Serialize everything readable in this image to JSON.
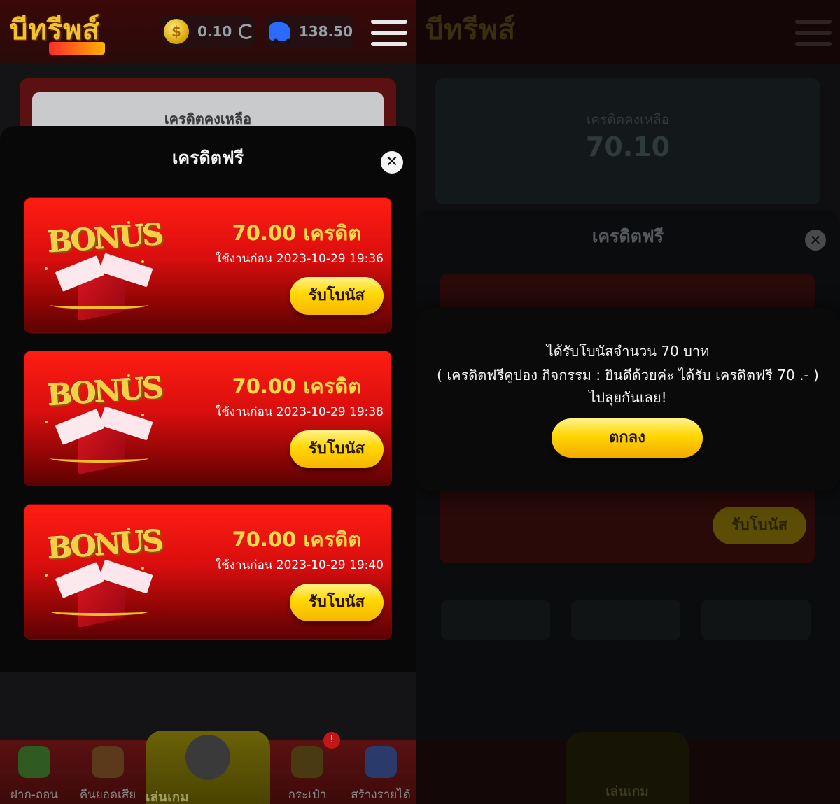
{
  "header": {
    "logo_text": "บีทรีพส์",
    "coin_balance": "0.10",
    "credit_balance": "138.50",
    "coin_icon": "$"
  },
  "credit_summary": {
    "label": "เครดิตคงเหลือ"
  },
  "sheet": {
    "title": "เครดิตฟรี",
    "close_symbol": "✕",
    "bonus_word": "BONUS",
    "items": [
      {
        "amount": "70.00 เครดิต",
        "expire": "ใช้งานก่อน 2023-10-29 19:36",
        "button": "รับโบนัส"
      },
      {
        "amount": "70.00 เครดิต",
        "expire": "ใช้งานก่อน 2023-10-29 19:38",
        "button": "รับโบนัส"
      },
      {
        "amount": "70.00 เครดิต",
        "expire": "ใช้งานก่อน 2023-10-29 19:40",
        "button": "รับโบนัส"
      }
    ]
  },
  "bottom_nav": {
    "items": [
      {
        "label": "ฝาก-ถอน",
        "icon": "deposit-withdraw-icon"
      },
      {
        "label": "คืนยอดเสีย",
        "icon": "cashback-icon"
      },
      {
        "label": "เล่นเกม",
        "icon": "slot-machine-icon"
      },
      {
        "label": "กระเป๋า",
        "icon": "wallet-icon"
      },
      {
        "label": "สร้างรายได้",
        "icon": "affiliate-icon"
      }
    ],
    "badge": "!"
  },
  "right": {
    "credit_label": "เครดิตคงเหลือ",
    "credit_value": "70.10",
    "sheet_title": "เครดิตฟรี",
    "bonus_amount": "70.00 เครดิต",
    "claim_button": "รับโบนัส",
    "nav_center_label": "เล่นเกม",
    "dialog": {
      "line1": "ได้รับโบนัสจำนวน 70 บาท",
      "line2": "( เครดิตฟรีคูปอง กิจกรรม : ยินดีด้วยค่ะ ได้รับ เครดิตฟรี 70 .- )",
      "line3": "ไปลุยกันเลย!",
      "ok_button": "ตกลง"
    }
  },
  "colors": {
    "accent_gold": "#ffd700",
    "bonus_red": "#e01010",
    "amount_yellow": "#ffd94a"
  }
}
